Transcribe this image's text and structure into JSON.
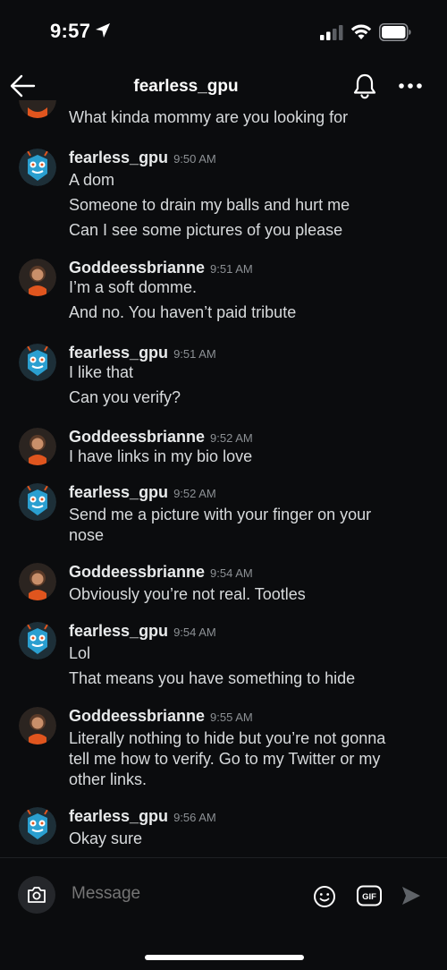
{
  "status_bar": {
    "time": "9:57"
  },
  "header": {
    "title": "fearless_gpu"
  },
  "top_partial": {
    "text": "What kinda mommy are you looking for"
  },
  "messages": [
    {
      "user": "fearless_gpu",
      "time": "9:50 AM",
      "lines": [
        "A dom",
        "Someone to drain my balls and hurt me",
        "Can I see some pictures of you please"
      ]
    },
    {
      "user": "Goddeessbrianne",
      "time": "9:51 AM",
      "lines": [
        "I’m a soft domme.",
        "And no. You haven’t paid tribute"
      ]
    },
    {
      "user": "fearless_gpu",
      "time": "9:51 AM",
      "lines": [
        "I like that",
        "Can you verify?"
      ]
    },
    {
      "user": "Goddeessbrianne",
      "time": "9:52 AM",
      "lines": [
        "I have links in my bio love"
      ]
    },
    {
      "user": "fearless_gpu",
      "time": "9:52 AM",
      "lines": [
        "Send me a picture with your finger on your",
        "nose"
      ]
    },
    {
      "user": "Goddeessbrianne",
      "time": "9:54 AM",
      "lines": [
        "Obviously you’re not real. Tootles"
      ]
    },
    {
      "user": "fearless_gpu",
      "time": "9:54 AM",
      "lines": [
        "Lol",
        "That means you have something to hide"
      ]
    },
    {
      "user": "Goddeessbrianne",
      "time": "9:55 AM",
      "lines": [
        "Literally nothing to hide but you’re not gonna",
        "tell me how to verify. Go to my Twitter or my",
        "other links."
      ]
    },
    {
      "user": "fearless_gpu",
      "time": "9:56 AM",
      "lines": [
        "Okay sure"
      ]
    }
  ],
  "composer": {
    "placeholder": "Message"
  },
  "colors": {
    "background": "#0b0c0e",
    "text": "#d7dadc",
    "timestamp": "#8c9094",
    "avatar_robot": "#2a9fd0",
    "avatar_girl": "#e0551e"
  },
  "icons": [
    "location-arrow-icon",
    "signal-icon",
    "wifi-icon",
    "battery-icon",
    "back-arrow-icon",
    "bell-icon",
    "more-icon",
    "camera-icon",
    "emoji-icon",
    "gif-icon",
    "send-icon"
  ]
}
